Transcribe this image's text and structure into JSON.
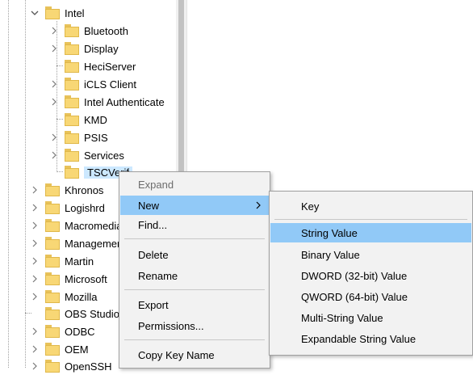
{
  "tree": {
    "parent": {
      "label": "Intel"
    },
    "children": [
      {
        "label": "Bluetooth"
      },
      {
        "label": "Display"
      },
      {
        "label": "HeciServer"
      },
      {
        "label": "iCLS Client"
      },
      {
        "label": "Intel Authenticate"
      },
      {
        "label": "KMD"
      },
      {
        "label": "PSIS"
      },
      {
        "label": "Services"
      },
      {
        "label": "TSCVerif"
      }
    ],
    "siblings": [
      {
        "label": "Khronos"
      },
      {
        "label": "Logishrd"
      },
      {
        "label": "Macromedia"
      },
      {
        "label": "Management"
      },
      {
        "label": "Martin"
      },
      {
        "label": "Microsoft"
      },
      {
        "label": "Mozilla"
      },
      {
        "label": "OBS Studio"
      },
      {
        "label": "ODBC"
      },
      {
        "label": "OEM"
      },
      {
        "label": "OpenSSH"
      }
    ]
  },
  "context_menu": {
    "expand": "Expand",
    "new": "New",
    "find": "Find...",
    "delete": "Delete",
    "rename": "Rename",
    "export": "Export",
    "permissions": "Permissions...",
    "copy_key_name": "Copy Key Name"
  },
  "submenu": {
    "key": "Key",
    "string_value": "String Value",
    "binary_value": "Binary Value",
    "dword_value": "DWORD (32-bit) Value",
    "qword_value": "QWORD (64-bit) Value",
    "multi_string_value": "Multi-String Value",
    "expandable_string_value": "Expandable String Value"
  },
  "colors": {
    "highlight": "#91c9f7",
    "selected_node": "#cce8ff",
    "folder": "#f8d775",
    "menu_bg": "#f2f2f2"
  },
  "icons": [
    "folder-icon",
    "chevron-right-icon",
    "chevron-down-icon",
    "submenu-arrow-icon"
  ]
}
